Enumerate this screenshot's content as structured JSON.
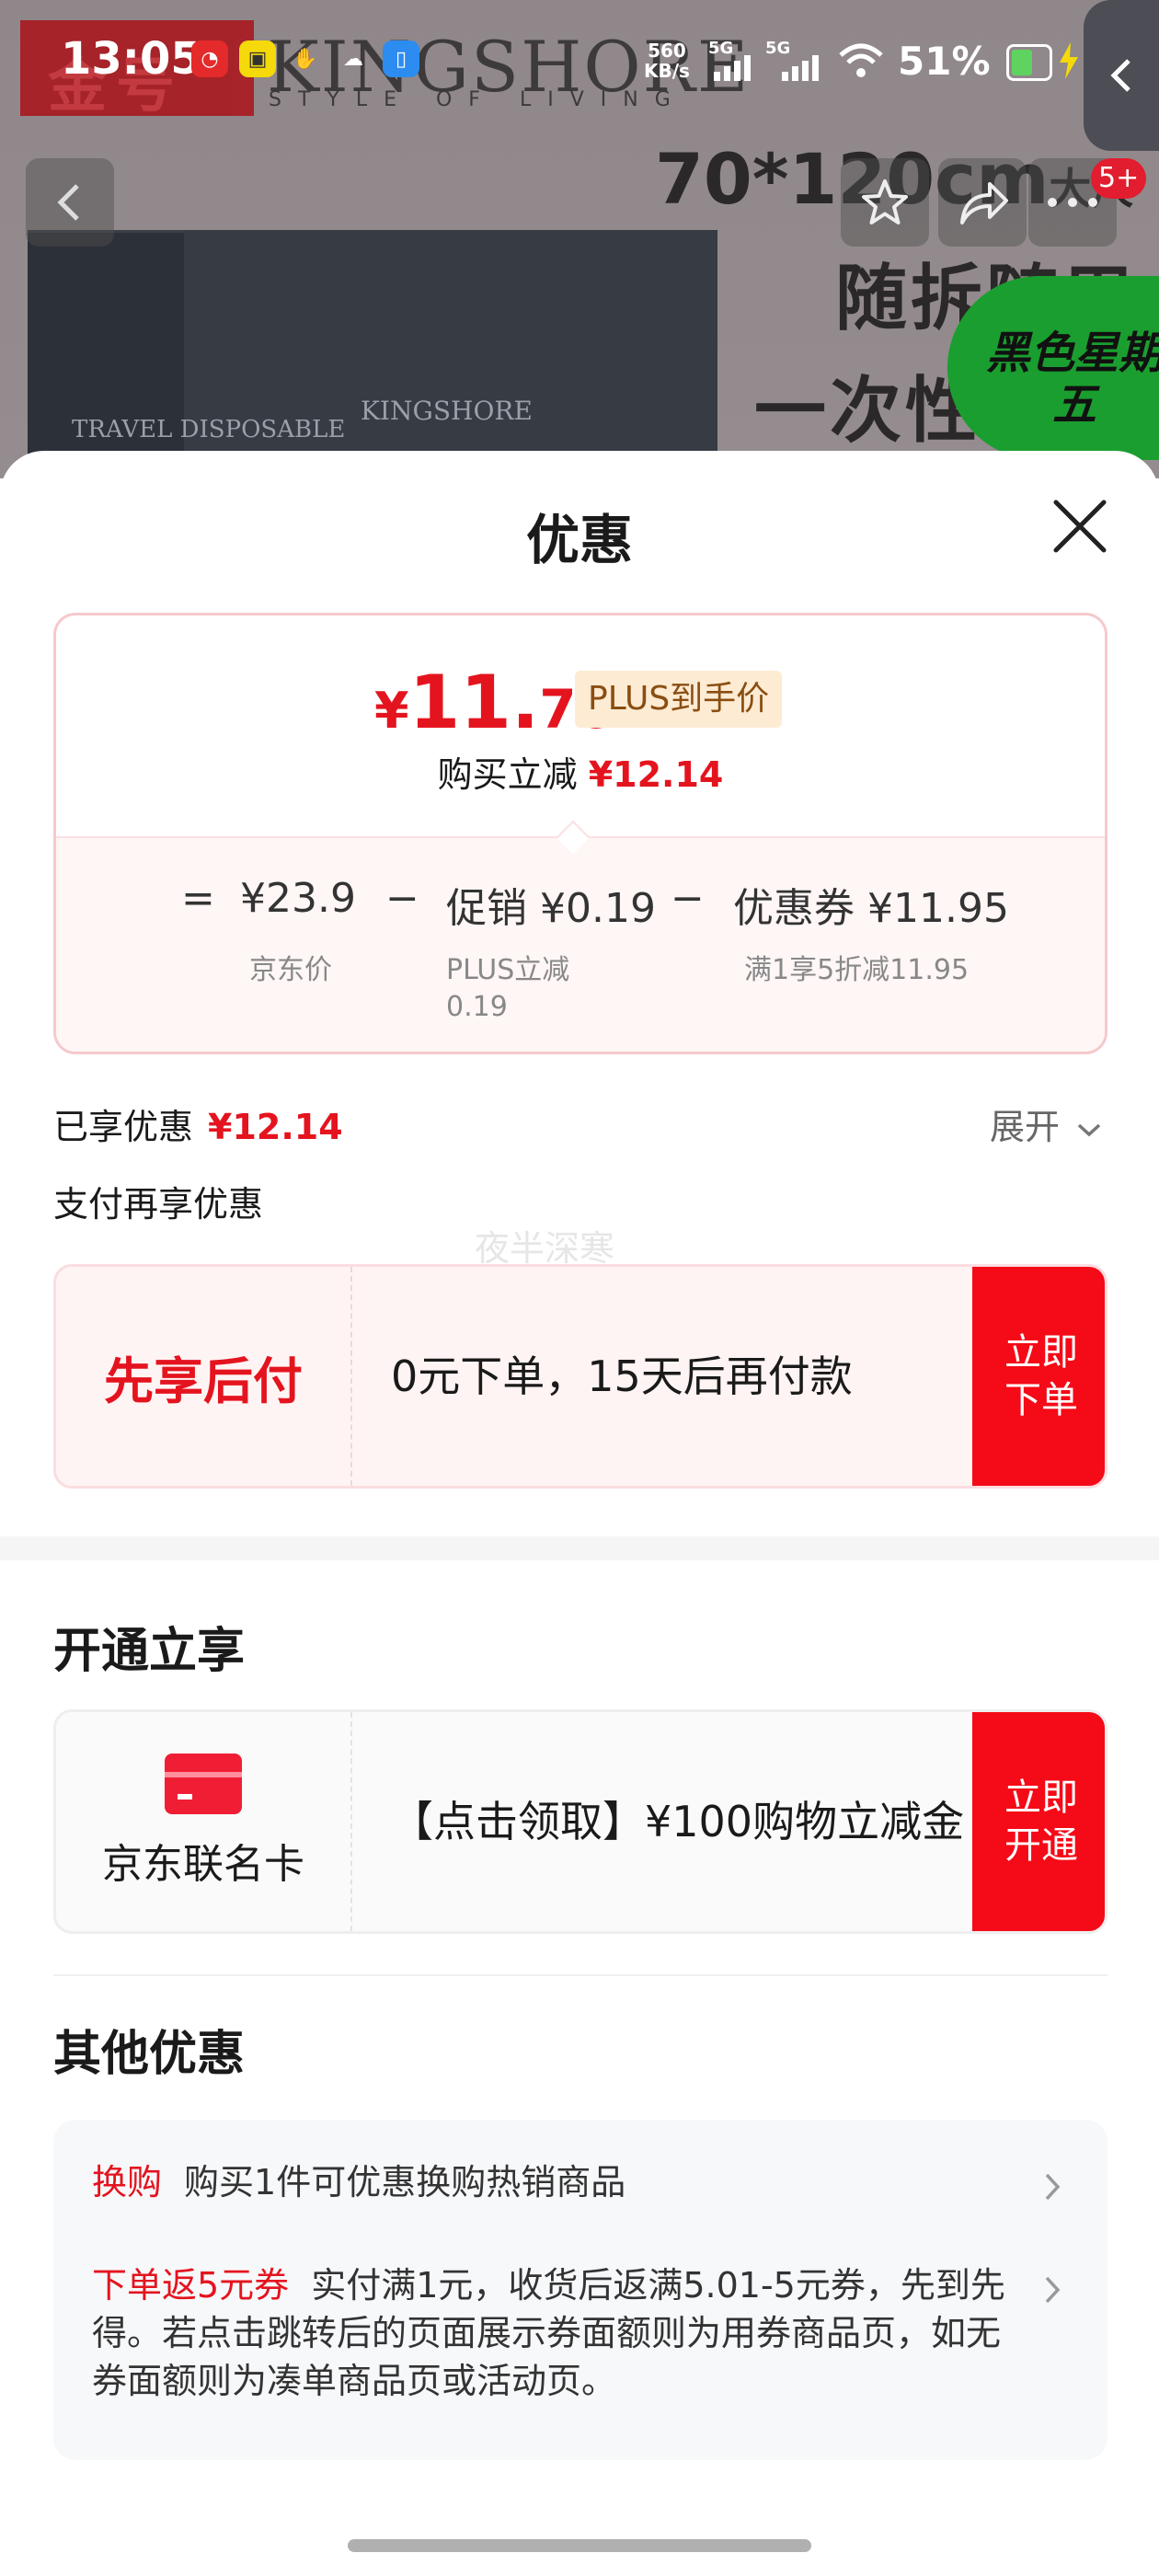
{
  "status_bar": {
    "time": "13:05",
    "net_speed_value": "560",
    "net_speed_unit": "KB/s",
    "signal1_label": "5G",
    "signal2_label": "5G",
    "battery_percent": "51%"
  },
  "background": {
    "brand_logo_text": "金号",
    "brand_name": "KINGSHORE",
    "brand_tagline": "STYLE OF LIVING",
    "size_text": "70*120cm",
    "size_suffix": "大尺",
    "line1": "随拆随用",
    "line2": "一次性",
    "product_text1": "TRAVEL DISPOSABLE",
    "product_text2": "KINGSHORE",
    "promo_text": "黑色星期五",
    "cart_badge": "5+"
  },
  "sheet": {
    "title": "优惠"
  },
  "price_card": {
    "final_price_symbol": "¥",
    "final_price_int": "11.",
    "final_price_dec": "76",
    "plus_tag": "PLUS到手价",
    "save_label": "购买立减",
    "save_amount": "¥12.14",
    "eq_sign": "=",
    "jd_price": "¥23.9",
    "jd_price_label": "京东价",
    "minus1": "−",
    "promo_label": "促销 ¥0.19",
    "promo_sub": "PLUS立减 0.19",
    "minus2": "−",
    "coupon_label": "优惠券 ¥11.95",
    "coupon_sub": "满1享5折减11.95"
  },
  "enjoyed": {
    "label": "已享优惠",
    "amount": "¥12.14",
    "expand_label": "展开"
  },
  "pay_more_title": "支付再享优惠",
  "watermark": "夜半深寒",
  "bnpl_card": {
    "label": "先享后付",
    "description": "0元下单，15天后再付款",
    "button": "立即下单"
  },
  "open_section": {
    "title": "开通立享",
    "card_label": "京东联名卡",
    "description": "【点击领取】¥100购物立减金",
    "button": "立即开通"
  },
  "other_section": {
    "title": "其他优惠",
    "items": [
      {
        "tag": "换购",
        "text": "购买1件可优惠换购热销商品"
      },
      {
        "tag": "下单返5元券",
        "text": "实付满1元，收货后返满5.01-5元券，先到先得。若点击跳转后的页面展示券面额则为用券商品页，如无券面额则为凑单商品页或活动页。"
      }
    ]
  },
  "colors": {
    "accent_red": "#e4141f",
    "button_red": "#f50a17",
    "plus_tag_bg": "#fdebd3"
  }
}
